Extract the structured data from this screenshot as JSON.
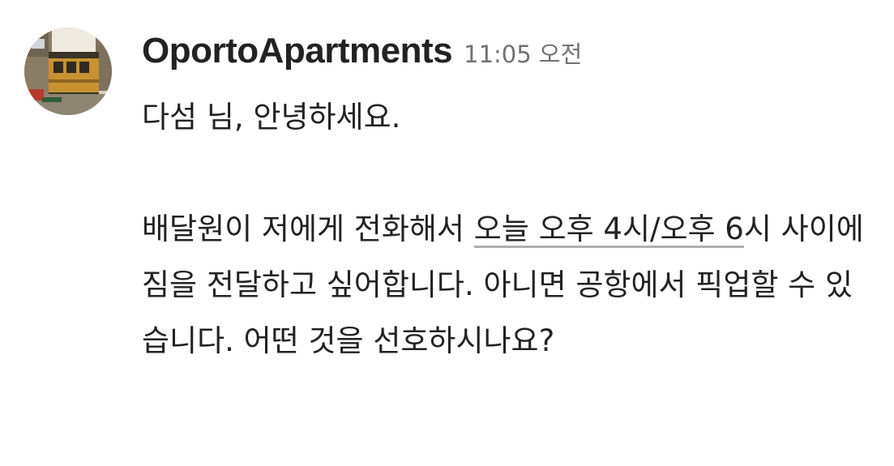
{
  "message": {
    "sender": "OportoApartments",
    "timestamp": "11:05 오전",
    "avatar_icon": "tram-photo-avatar",
    "greeting": "다섬 님, 안녕하세요.",
    "paragraph": {
      "part1": "배달원이 저에게 전화해서 ",
      "link_text": "오늘 오후 4시/오후 6",
      "part2": "시 사이에 짐을 전달하고 싶어합니다. 아니면 공항에서 픽업할 수 있습니다. 어떤 것을 선호하시나요?"
    }
  },
  "colors": {
    "text": "#222222",
    "timestamp": "#717171",
    "link_underline": "#b0b0b0",
    "background": "#ffffff"
  }
}
